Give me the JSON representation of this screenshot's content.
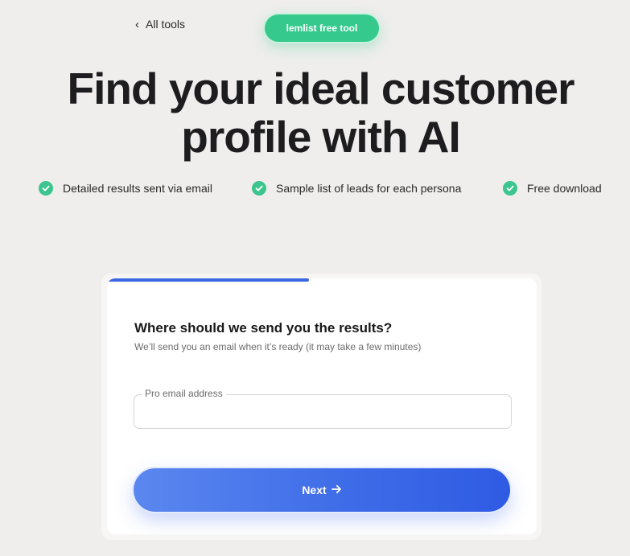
{
  "nav": {
    "back_label": "All tools",
    "badge": "lemlist free tool"
  },
  "hero": {
    "title": "Find your ideal customer profile with AI"
  },
  "features": [
    {
      "label": "Detailed results sent via email",
      "icon": "check-circle-icon"
    },
    {
      "label": "Sample list of leads for each persona",
      "icon": "check-circle-icon"
    },
    {
      "label": "Free download",
      "icon": "check-circle-icon"
    }
  ],
  "form": {
    "progress_percent": 47,
    "question": "Where should we send you the results?",
    "subtitle": "We’ll send you an email when it’s ready (it may take a few minutes)",
    "email_label": "Pro email address",
    "email_value": "",
    "next_label": "Next"
  },
  "colors": {
    "accent_blue": "#3a66e2",
    "badge_green": "#35c98d",
    "check_green": "#3cc58d",
    "background": "#efeeec"
  }
}
